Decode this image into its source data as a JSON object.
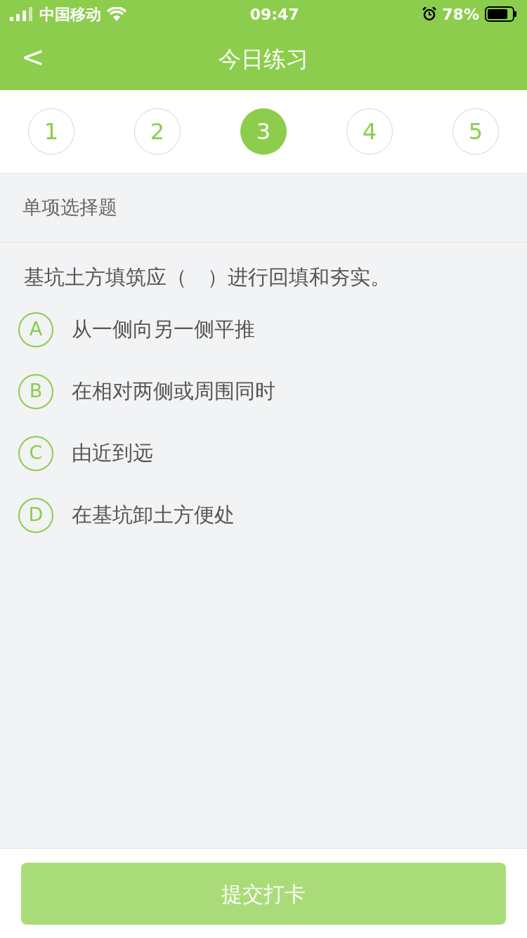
{
  "status_bar": {
    "carrier": "中国移动",
    "time": "09:47",
    "battery": "78%"
  },
  "nav": {
    "back": "<",
    "title": "今日练习"
  },
  "questions": [
    {
      "label": "1",
      "selected": false
    },
    {
      "label": "2",
      "selected": false
    },
    {
      "label": "3",
      "selected": true
    },
    {
      "label": "4",
      "selected": false
    },
    {
      "label": "5",
      "selected": false
    }
  ],
  "section": "单项选择题",
  "question": "基坑土方填筑应（　）进行回填和夯实。",
  "options": [
    {
      "letter": "A",
      "text": "从一侧向另一侧平推"
    },
    {
      "letter": "B",
      "text": "在相对两侧或周围同时"
    },
    {
      "letter": "C",
      "text": "由近到远"
    },
    {
      "letter": "D",
      "text": "在基坑卸土方便处"
    }
  ],
  "submit": {
    "label": "提交打卡",
    "disabled": true
  }
}
